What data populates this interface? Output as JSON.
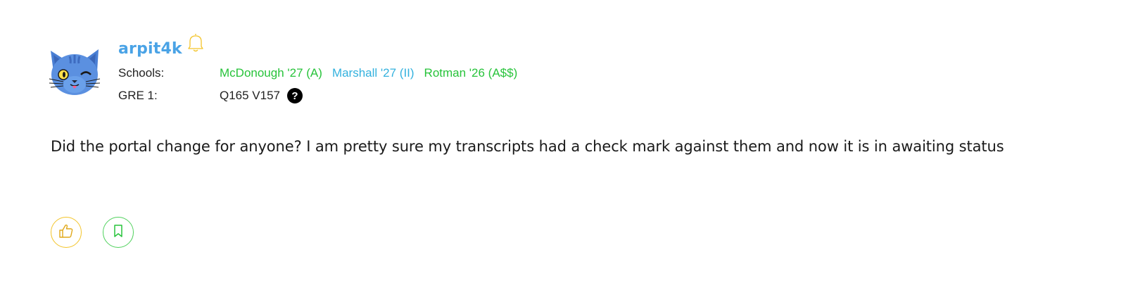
{
  "post": {
    "author": {
      "username": "arpit4k",
      "avatar_icon": "cat-avatar-icon",
      "notification_icon": "bell-icon"
    },
    "schools": {
      "label": "Schools:",
      "items": [
        {
          "text": "McDonough '27 (A)",
          "color": "#27c33a"
        },
        {
          "text": "Marshall '27 (II)",
          "color": "#33b1de"
        },
        {
          "text": "Rotman '26 (A$$)",
          "color": "#27c33a"
        }
      ]
    },
    "gre": {
      "label": "GRE 1:",
      "score": "Q165 V157",
      "help_badge": "?"
    },
    "body": "Did the portal change for anyone? I am pretty sure my transcripts had a check mark against them and now it is in awaiting status",
    "actions": {
      "like_icon": "thumbs-up-icon",
      "bookmark_icon": "bookmark-icon",
      "like_color": "#f3c428",
      "bookmark_color": "#4fd15c"
    }
  }
}
